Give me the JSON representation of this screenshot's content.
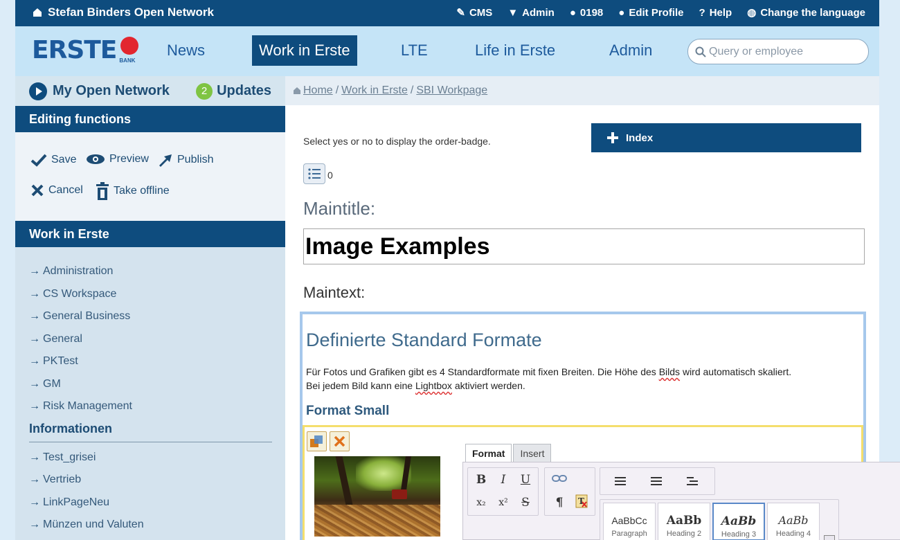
{
  "topbar": {
    "site_title": "Stefan Binders Open Network",
    "cms": "CMS",
    "admin": "Admin",
    "user_id": "0198",
    "edit_profile": "Edit Profile",
    "help": "Help",
    "change_language": "Change the language"
  },
  "nav": {
    "logo_text": "ERSTE",
    "logo_sub": "BANK",
    "items": [
      "News",
      "Work in Erste",
      "LTE",
      "Life in Erste",
      "Admin"
    ],
    "active_index": 1,
    "search_placeholder": "Query or employee"
  },
  "sidebar": {
    "my_open_network": "My Open Network",
    "updates_count": "2",
    "updates_label": "Updates",
    "editing_title": "Editing functions",
    "save": "Save",
    "preview": "Preview",
    "publish": "Publish",
    "cancel": "Cancel",
    "take_offline": "Take offline",
    "work_title": "Work in Erste",
    "work_items": [
      "Administration",
      "CS Workspace",
      "General Business",
      "General",
      "PKTest",
      "GM",
      "Risk Management"
    ],
    "info_title": "Informationen",
    "info_items": [
      "Test_grisei",
      "Vertrieb",
      "LinkPageNeu",
      "Münzen und Valuten"
    ]
  },
  "breadcrumb": {
    "home": "Home",
    "sep": "/",
    "work": "Work in Erste",
    "page": "SBI Workpage"
  },
  "content": {
    "select_text": "Select yes or no to display the order-badge.",
    "index_button": "Index",
    "list_count": "0",
    "maintitle_label": "Maintitle:",
    "maintitle_value": "Image Examples",
    "maintext_label": "Maintext:",
    "editor": {
      "heading": "Definierte Standard Formate",
      "para_a": "Für Fotos und Grafiken gibt es 4 Standardformate mit fixen Breiten. Die Höhe des ",
      "para_word1": "Bilds",
      "para_b": " wird automatisch skaliert.",
      "para_c": "Bei jedem Bild kann eine ",
      "para_word2": "Lightbox",
      "para_d": " aktiviert werden.",
      "format_small": "Format Small"
    }
  },
  "ribbon": {
    "tab_format": "Format",
    "tab_insert": "Insert",
    "bold": "B",
    "italic": "I",
    "underline": "U",
    "subscript": "x₂",
    "superscript": "x²",
    "strike": "S",
    "pilcrow": "¶",
    "styles": [
      {
        "preview": "AaBbCc",
        "name": "Paragraph"
      },
      {
        "preview": "AaBb",
        "name": "Heading 2"
      },
      {
        "preview": "AaBb",
        "name": "Heading 3"
      },
      {
        "preview": "AaBb",
        "name": "Heading 4"
      }
    ]
  },
  "colors": {
    "brand_dark": "#0e4c7e",
    "nav_bg": "#c5e4f7",
    "accent_green": "#7fc443",
    "logo_red": "#e2262f"
  }
}
